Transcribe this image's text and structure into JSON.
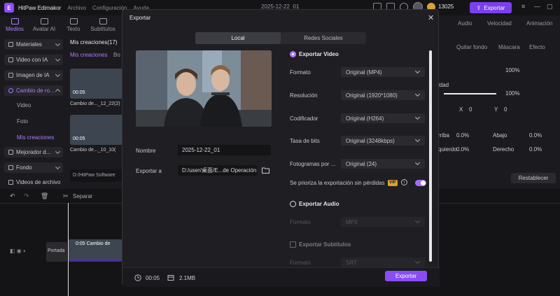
{
  "app": {
    "name": "HitPaw Edimakor",
    "menus": [
      "Archivo",
      "Configuración",
      "Ayuda"
    ],
    "project_title": "2025-12-22_01",
    "coins": "13025",
    "export_label": "Exportar"
  },
  "top_tabs": [
    "Medios",
    "Avatar AI",
    "Texto",
    "Subtítulos"
  ],
  "sidebar": {
    "items": [
      "Materiales",
      "Video con IA",
      "Imagen de IA",
      "Cambio de ro...",
      "Mejorador d...",
      "Fondo",
      "Videos de archivo"
    ],
    "subitems": [
      "Video",
      "Foto",
      "Mis creaciones"
    ]
  },
  "mid": {
    "header": "Mis creaciones(17)",
    "tab": "Mis creaciones",
    "tab2": "Bo",
    "items": [
      "Cambio de..._12_22(2)",
      "Cambio de..._10_10("
    ],
    "durations": [
      "00:05",
      "00:05"
    ],
    "path": "D:/HitPaw Software"
  },
  "right_panel": {
    "tabs": [
      "Audio",
      "Velocidad",
      "Animación"
    ],
    "subtabs": [
      "Quitar fondo",
      "Máscara",
      "Efecto"
    ],
    "zoom": [
      "100%",
      "100%"
    ],
    "xy": [
      "X",
      "0",
      "Y",
      "0"
    ],
    "pos": [
      "0.0%",
      "Abajo",
      "0.0%",
      "Derecho",
      "0.0%"
    ],
    "labels": [
      "ldad",
      "rriba",
      "quierdo"
    ],
    "reset": "Restablecer"
  },
  "timeline": {
    "tool": "Separar",
    "clip_label": "0:05 Cambio de",
    "track_label": "Portada"
  },
  "dialog": {
    "title": "Exportar",
    "tabs": [
      "Local",
      "Redes Sociales"
    ],
    "name_label": "Nombre",
    "name_value": "2025-12-22_01",
    "export_to_label": "Exportar a",
    "export_path": "D:/user/桌面/E...de Operación",
    "video_section": "Exportar Video",
    "rows": [
      {
        "label": "Formato",
        "value": "Original (MP4)"
      },
      {
        "label": "Resolución",
        "value": "Original (1920*1080)"
      },
      {
        "label": "Codificador",
        "value": "Original (H264)"
      },
      {
        "label": "Tasa de bits",
        "value": "Original (3248kbps)"
      },
      {
        "label": "Fotogramas por ...",
        "value": "Original (24)"
      }
    ],
    "lossless_label": "Se prioriza la exportación sin pérdidas",
    "vip": "VIP",
    "audio_section": "Exportar Audio",
    "audio_format_label": "Formato",
    "audio_format_value": "MP3",
    "subtitles_section": "Exportar Subtítulos",
    "sub_format_label": "Formato",
    "sub_format_value": "SRT",
    "duration": "00:05",
    "size": "2.1MB",
    "export_button": "Exportar"
  },
  "colors": {
    "accent": "#8a4cf5",
    "background": "#1b1b1f",
    "dialog": "#1f1f23"
  }
}
